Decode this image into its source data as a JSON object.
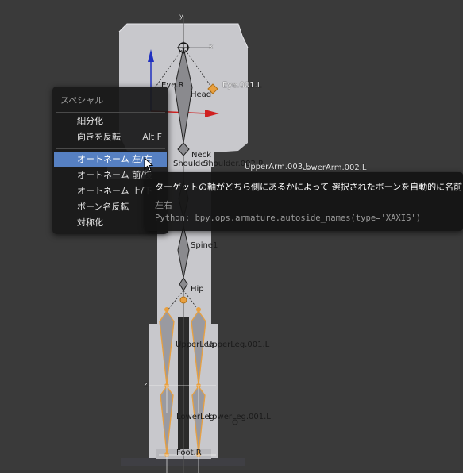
{
  "viewport": {
    "bone_labels": {
      "eye_r": "Eye.R",
      "eye_l": "Eye.001.L",
      "head": "Head",
      "neck": "Neck",
      "shoulder_r": "Shoulder",
      "shoulder_l": "Shoulder.002.R",
      "upperarm_l": "UpperArm.003.L",
      "lowerarm_l": "LowerArm.002.L",
      "spine": "Spine",
      "spine1": "Spine1",
      "hip": "Hip",
      "upperleg_r": "UpperLeg",
      "upperleg_l": "UpperLeg.001.L",
      "lowerleg_r": "LowerLeg",
      "lowerleg_l": "LowerLeg.001.L",
      "foot_r": "Foot.R",
      "axis_x": "x",
      "axis_y": "y",
      "axis_z": "z"
    },
    "colors": {
      "background": "#3a3a3a",
      "mesh": "#c4c4c8",
      "bone_selected": "#e8a040",
      "x_axis": "#d02020",
      "z_axis": "#2030c0"
    }
  },
  "menu": {
    "title": "スペシャル",
    "items": [
      {
        "label": "細分化",
        "shortcut": ""
      },
      {
        "label": "向きを反転",
        "shortcut": "Alt F"
      },
      {
        "label": "オートネーム 左/右",
        "shortcut": "",
        "highlighted": true
      },
      {
        "label": "オートネーム 前/後",
        "shortcut": ""
      },
      {
        "label": "オートネーム 上/下",
        "shortcut": ""
      },
      {
        "label": "ボーン名反転",
        "shortcut": ""
      },
      {
        "label": "対称化",
        "shortcut": ""
      }
    ]
  },
  "tooltip": {
    "title": "ターゲットの軸がどちら側にあるかによって 選択されたボーンを自動的に名前",
    "subtitle": "左右",
    "python": "Python: bpy.ops.armature.autoside_names(type='XAXIS')"
  },
  "icons": {
    "cursor": "mouse-pointer-icon",
    "cursor3d": "3d-cursor-icon"
  }
}
